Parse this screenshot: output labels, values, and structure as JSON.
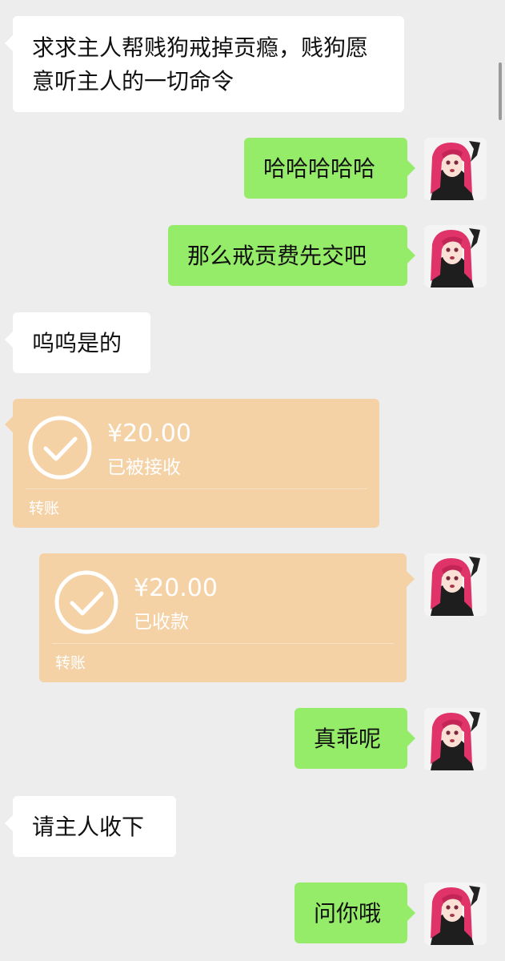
{
  "messages": {
    "m1": {
      "text": "求求主人帮贱狗戒掉贡瘾，贱狗愿意听主人的一切命令"
    },
    "m2": {
      "text": "哈哈哈哈哈"
    },
    "m3": {
      "text": "那么戒贡费先交吧"
    },
    "m4": {
      "text": "呜呜是的"
    },
    "m5": {
      "amount": "¥20.00",
      "status": "已被接收",
      "label": "转账"
    },
    "m6": {
      "amount": "¥20.00",
      "status": "已收款",
      "label": "转账"
    },
    "m7": {
      "text": "真乖呢"
    },
    "m8": {
      "text": "请主人收下"
    },
    "m9": {
      "text": "问你哦"
    }
  },
  "colors": {
    "background": "#ededed",
    "incoming_bubble": "#ffffff",
    "outgoing_bubble": "#95ec69",
    "transfer_card": "#f5d2a6"
  },
  "icons": {
    "avatar": "anime-character-avatar",
    "transfer": "check-circle-icon"
  }
}
